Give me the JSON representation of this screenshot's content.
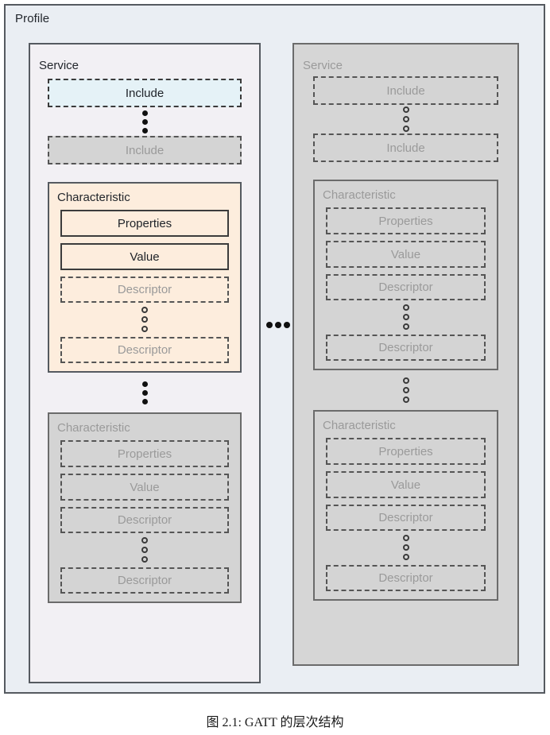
{
  "figure": {
    "caption": "图 2.1: GATT 的层次结构",
    "profile_label": "Profile"
  },
  "labels": {
    "service": "Service",
    "include": "Include",
    "characteristic": "Characteristic",
    "properties": "Properties",
    "value": "Value",
    "descriptor": "Descriptor"
  },
  "colors": {
    "profile_bg": "#eaeef3",
    "service_active_bg": "#f2f0f4",
    "service_muted_bg": "#d6d6d6",
    "include_highlight_bg": "#e5f2f7",
    "characteristic_highlight_bg": "#fdeddd",
    "muted_box_bg": "#d4d4d4",
    "border_dark": "#555a60",
    "text_dark": "#22262c",
    "text_muted": "#9a9a9a"
  },
  "columns": [
    {
      "id": "service-active",
      "state": "active",
      "title": "Service",
      "includes": [
        {
          "label": "Include",
          "state": "highlight"
        },
        {
          "label": "Include",
          "state": "muted"
        }
      ],
      "include_ellipsis": "solid",
      "characteristics": [
        {
          "title": "Characteristic",
          "state": "highlight",
          "properties": "Properties",
          "value": "Value",
          "descriptors": [
            "Descriptor",
            "Descriptor"
          ],
          "descriptor_ellipsis": "hollow"
        },
        {
          "title": "Characteristic",
          "state": "muted",
          "properties": "Properties",
          "value": "Value",
          "descriptors": [
            "Descriptor",
            "Descriptor"
          ],
          "descriptor_ellipsis": "hollow"
        }
      ],
      "characteristic_ellipsis": "solid"
    },
    {
      "id": "service-muted",
      "state": "muted",
      "title": "Service",
      "includes": [
        {
          "label": "Include",
          "state": "muted"
        },
        {
          "label": "Include",
          "state": "muted"
        }
      ],
      "include_ellipsis": "hollow",
      "characteristics": [
        {
          "title": "Characteristic",
          "state": "muted",
          "properties": "Properties",
          "value": "Value",
          "descriptors": [
            "Descriptor",
            "Descriptor"
          ],
          "descriptor_ellipsis": "hollow"
        },
        {
          "title": "Characteristic",
          "state": "muted",
          "properties": "Properties",
          "value": "Value",
          "descriptors": [
            "Descriptor",
            "Descriptor"
          ],
          "descriptor_ellipsis": "hollow"
        }
      ],
      "characteristic_ellipsis": "hollow"
    }
  ],
  "between_columns_ellipsis": {
    "style": "solid-horizontal",
    "count": 3
  }
}
